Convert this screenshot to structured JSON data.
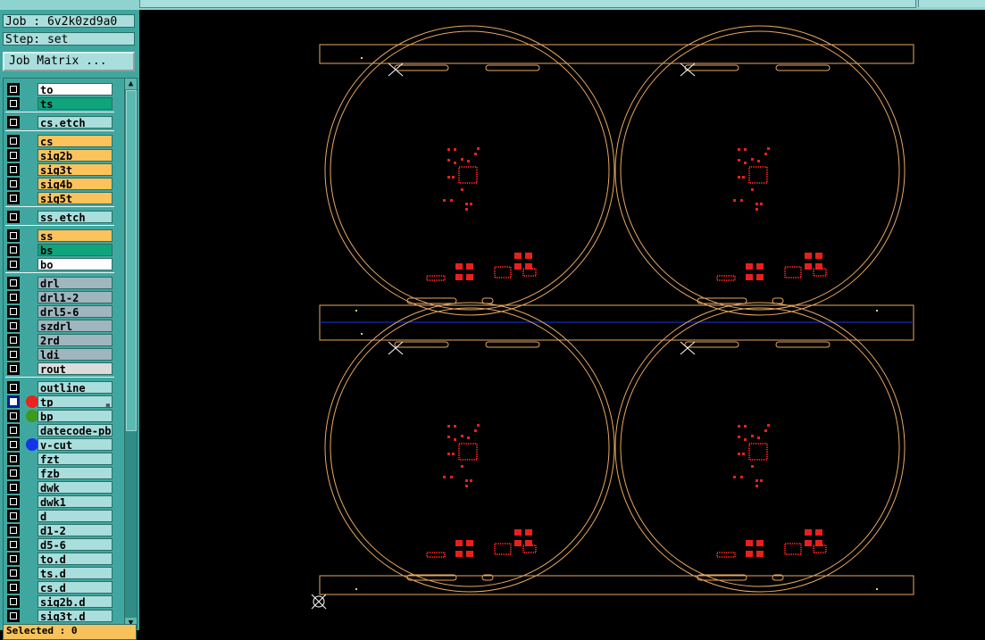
{
  "job": "Job : 6v2k0zd9a0",
  "step": "Step: set",
  "matrix_button": "Job Matrix ...",
  "selected": "Selected : 0",
  "layers": [
    {
      "name": "to",
      "color": "#ffffff"
    },
    {
      "name": "ts",
      "color": "#10a47c"
    },
    {
      "name": "cs.etch",
      "color": "#a9dedc"
    },
    {
      "name": "cs",
      "color": "#fcc35c"
    },
    {
      "name": "sig2b",
      "color": "#fcc35c"
    },
    {
      "name": "sig3t",
      "color": "#fcc35c"
    },
    {
      "name": "sig4b",
      "color": "#fcc35c"
    },
    {
      "name": "sig5t",
      "color": "#fcc35c"
    },
    {
      "name": "ss.etch",
      "color": "#a9dedc"
    },
    {
      "name": "ss",
      "color": "#fcc35c"
    },
    {
      "name": "bs",
      "color": "#10a47c"
    },
    {
      "name": "bo",
      "color": "#ffffff"
    },
    {
      "name": "drl",
      "color": "#9fb6bf"
    },
    {
      "name": "drl1-2",
      "color": "#9fb6bf"
    },
    {
      "name": "drl5-6",
      "color": "#9fb6bf"
    },
    {
      "name": "szdrl",
      "color": "#9fb6bf"
    },
    {
      "name": "2rd",
      "color": "#9fb6bf"
    },
    {
      "name": "ldi",
      "color": "#9fb6bf"
    },
    {
      "name": "rout",
      "color": "#dcdcdc"
    },
    {
      "name": "outline",
      "color": "#a9dedc"
    },
    {
      "name": "tp",
      "color": "#a9dedc",
      "dot": "#e8241c",
      "selected": true,
      "badge": "▦"
    },
    {
      "name": "bp",
      "color": "#a9dedc",
      "dot": "#3c9a1c"
    },
    {
      "name": "datecode-pbe",
      "color": "#a9dedc"
    },
    {
      "name": "v-cut",
      "color": "#a9dedc",
      "dot": "#1434e8"
    },
    {
      "name": "fzt",
      "color": "#a9dedc"
    },
    {
      "name": "fzb",
      "color": "#a9dedc"
    },
    {
      "name": "dwk",
      "color": "#a9dedc"
    },
    {
      "name": "dwk1",
      "color": "#a9dedc"
    },
    {
      "name": "d",
      "color": "#a9dedc"
    },
    {
      "name": "d1-2",
      "color": "#a9dedc"
    },
    {
      "name": "d5-6",
      "color": "#a9dedc"
    },
    {
      "name": "to.d",
      "color": "#a9dedc"
    },
    {
      "name": "ts.d",
      "color": "#a9dedc"
    },
    {
      "name": "cs.d",
      "color": "#a9dedc"
    },
    {
      "name": "sig2b.d",
      "color": "#a9dedc"
    },
    {
      "name": "sig3t.d",
      "color": "#a9dedc"
    }
  ],
  "colors": {
    "outline": "#e8a860",
    "pads": "#e8201c",
    "vcut": "#1434e8",
    "panel_bg": "#3fa79f",
    "field_bg": "#a9dedc"
  }
}
